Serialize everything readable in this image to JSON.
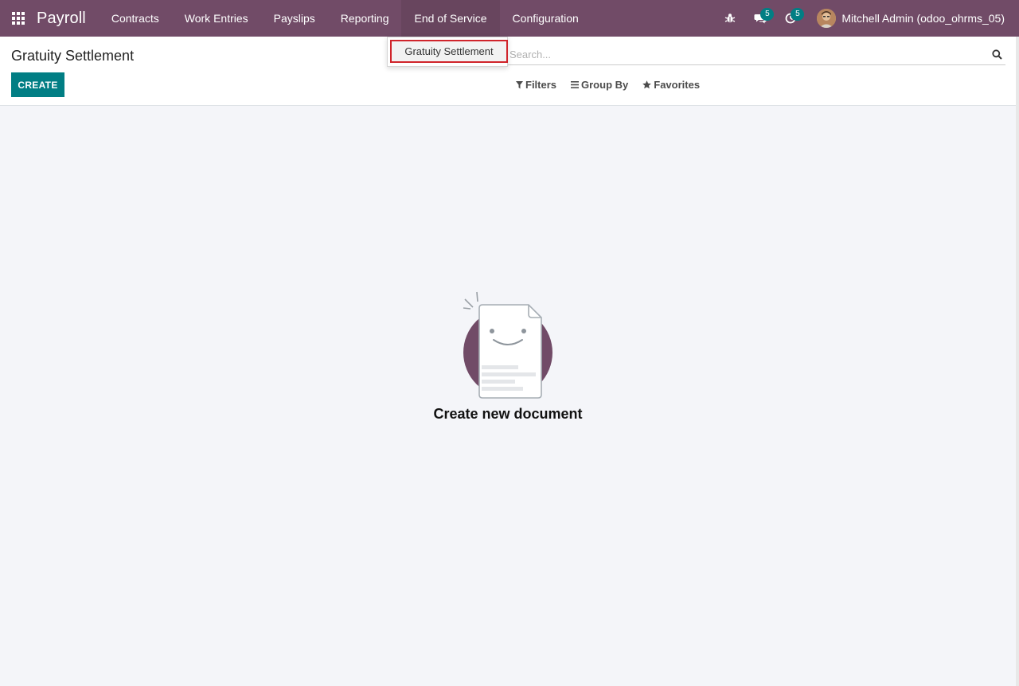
{
  "navbar": {
    "brand": "Payroll",
    "menu": [
      {
        "label": "Contracts"
      },
      {
        "label": "Work Entries"
      },
      {
        "label": "Payslips"
      },
      {
        "label": "Reporting"
      },
      {
        "label": "End of Service"
      },
      {
        "label": "Configuration"
      }
    ],
    "active_menu": "End of Service",
    "messages_badge": "5",
    "activities_badge": "5",
    "user_name": "Mitchell Admin (odoo_ohrms_05)"
  },
  "dropdown": {
    "items": [
      {
        "label": "Gratuity Settlement"
      }
    ]
  },
  "control_panel": {
    "title": "Gratuity Settlement",
    "create_label": "CREATE",
    "search_placeholder": "Search...",
    "filters_label": "Filters",
    "group_by_label": "Group By",
    "favorites_label": "Favorites"
  },
  "empty_state": {
    "title": "Create new document"
  },
  "colors": {
    "brand": "#714b67",
    "accent": "#017e84",
    "highlight": "#d0242b",
    "background": "#f4f5f9"
  }
}
